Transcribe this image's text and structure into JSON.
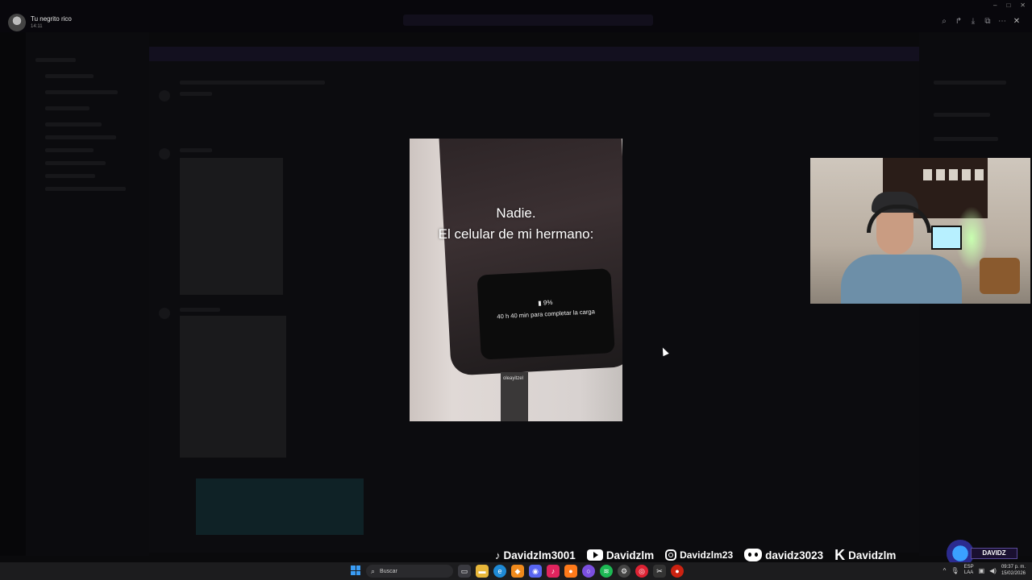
{
  "header": {
    "author": "Tu negrito rico",
    "time": "14:11"
  },
  "viewer_tools": [
    "zoom-icon",
    "forward-icon",
    "download-icon",
    "open-external-icon",
    "more-icon",
    "close-icon"
  ],
  "media": {
    "caption_line1": "Nadie.",
    "caption_line2": "El celular de mi hermano:",
    "battery": "9%",
    "charge_text": "40 h 40 min para completar la carga",
    "watermark": "oleayitzel"
  },
  "socials": [
    {
      "icon": "tiktok-icon",
      "handle": "Davidzlm3001"
    },
    {
      "icon": "youtube-icon",
      "handle": "Davidzlm"
    },
    {
      "icon": "instagram-icon",
      "handle": "Davidzlm23"
    },
    {
      "icon": "discord-icon",
      "handle": "davidz3023"
    },
    {
      "icon": "kick-icon",
      "handle": "Davidzlm"
    }
  ],
  "brand": {
    "badge": "DAVIDZ"
  },
  "taskbar": {
    "search_label": "Buscar",
    "lang_line1": "ESP",
    "lang_line2": "LAA",
    "time": "09:37 p. m.",
    "date": "15/02/2026"
  },
  "colors": {
    "accent_purple": "#13101f",
    "taskbar": "#1c1c1e",
    "windows_blue": "#3a9cf5"
  }
}
